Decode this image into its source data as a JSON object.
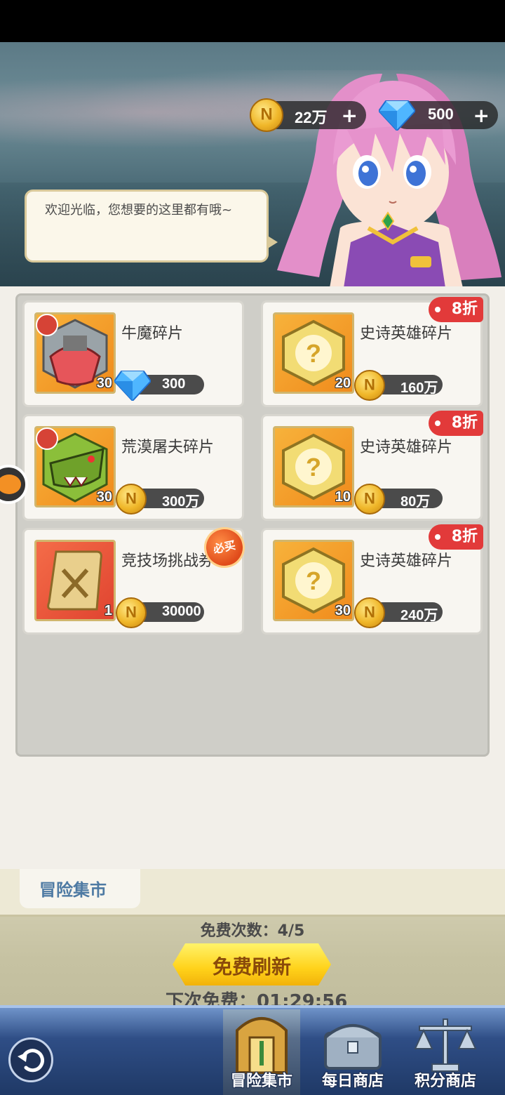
{
  "header": {
    "gold": {
      "icon": "gold-coin-icon",
      "amount": "22万"
    },
    "gems": {
      "icon": "diamond-icon",
      "amount": "500"
    },
    "npc_greeting": "欢迎光临，您想要的这里都有哦~"
  },
  "shop": {
    "items": [
      {
        "name": "牛魔碎片",
        "quantity": "30",
        "price": "300",
        "currency": "diamond",
        "discount": "",
        "badge": ""
      },
      {
        "name": "史诗英雄碎片",
        "quantity": "20",
        "price": "160万",
        "currency": "gold",
        "discount": "8折",
        "badge": ""
      },
      {
        "name": "荒漠屠夫碎片",
        "quantity": "30",
        "price": "300万",
        "currency": "gold",
        "discount": "",
        "badge": ""
      },
      {
        "name": "史诗英雄碎片",
        "quantity": "10",
        "price": "80万",
        "currency": "gold",
        "discount": "8折",
        "badge": ""
      },
      {
        "name": "竞技场挑战券",
        "quantity": "1",
        "price": "30000",
        "currency": "gold",
        "discount": "",
        "badge": "必买"
      },
      {
        "name": "史诗英雄碎片",
        "quantity": "30",
        "price": "240万",
        "currency": "gold",
        "discount": "8折",
        "badge": ""
      }
    ]
  },
  "footer": {
    "section_tab": "冒险集市",
    "free_count_label": "免费次数：4/5",
    "refresh_button": "免费刷新",
    "next_free_label": "下次免费：01:29:56"
  },
  "nav": {
    "items": [
      {
        "label": "冒险集市",
        "icon": "market-gate-icon",
        "active": true
      },
      {
        "label": "每日商店",
        "icon": "treasure-chest-icon",
        "active": false
      },
      {
        "label": "积分商店",
        "icon": "scales-icon",
        "active": false
      }
    ]
  },
  "colors": {
    "accent": "#ffd21a",
    "discount": "#e23a3a",
    "nav": "#2f4e86"
  }
}
